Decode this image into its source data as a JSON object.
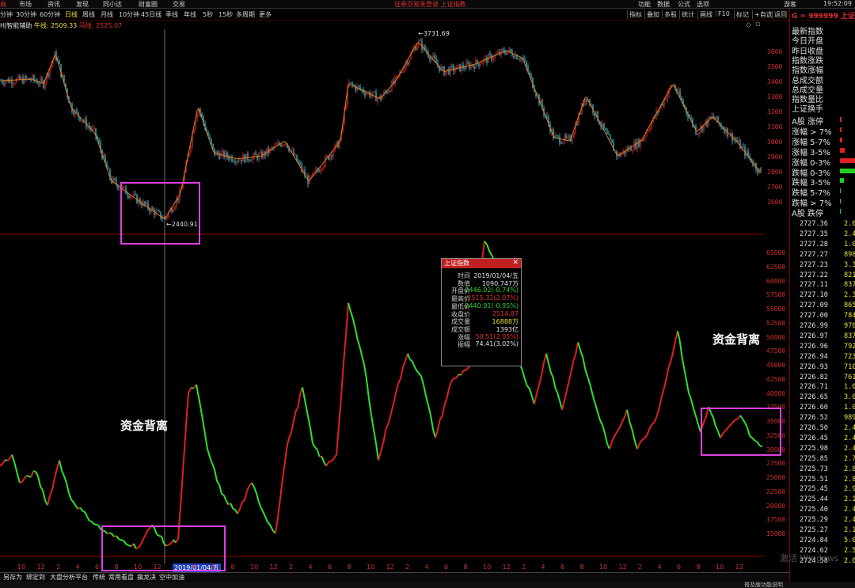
{
  "menu": {
    "items": [
      "市场",
      "资讯",
      "发现",
      "同小达",
      "财富圈",
      "交易"
    ],
    "center": "证券交易未登录  上证指数",
    "right": [
      "功能",
      "数据",
      "公式",
      "选项"
    ],
    "user": "游客",
    "time": "19:52:09"
  },
  "periods": {
    "items": [
      "分钟",
      "30分钟",
      "60分钟",
      "日线",
      "周线",
      "月线",
      "10分钟",
      "45日线",
      "季线",
      "年线",
      "5秒",
      "15秒",
      "多周期",
      "更多"
    ],
    "tools": [
      "指标",
      "叠加",
      "多股",
      "统计",
      "画线",
      "F10",
      "标记",
      "+自选",
      "返回"
    ]
  },
  "indicator_line": {
    "name": "HJ智能辅助",
    "bull_label": "牛线:",
    "bull_value": "2509.33",
    "horse_label": "马线:",
    "horse_value": "2525.07"
  },
  "main_chart": {
    "high_label": "3731.69",
    "low_label": "2440.91",
    "y_ticks": [
      "3600",
      "3500",
      "3400",
      "3300",
      "3200",
      "3100",
      "3000",
      "2900",
      "2800",
      "2700",
      "2600"
    ]
  },
  "sub_chart": {
    "y_ticks": [
      "65000",
      "62500",
      "60000",
      "57500",
      "55000",
      "52500",
      "50000",
      "47500",
      "45000",
      "42500",
      "40000",
      "37500",
      "35000",
      "32500",
      "30000",
      "27500",
      "25000",
      "22500",
      "20000",
      "17500",
      "15000"
    ],
    "annotation_left": "资金背离",
    "annotation_right": "资金背离"
  },
  "x_axis": {
    "ticks": [
      "10",
      "12",
      "2",
      "4",
      "6",
      "8",
      "10",
      "12",
      "2019/01/04/五",
      "4",
      "6",
      "8",
      "10",
      "12",
      "2",
      "4",
      "6",
      "8",
      "10",
      "12",
      "2",
      "4",
      "6",
      "8",
      "10",
      "12",
      "2",
      "4",
      "6",
      "8",
      "10",
      "12",
      "2",
      "4",
      "6",
      "8",
      "10",
      "12"
    ]
  },
  "popup": {
    "title": "上证指数",
    "rows": [
      {
        "k": "时间",
        "v": "2019/01/04/五",
        "c": "#e0e0e0"
      },
      {
        "k": "数值",
        "v": "1090.747万",
        "c": "#e0e0e0"
      },
      {
        "k": "开盘价",
        "v": "2446.02(-0.74%)",
        "c": "#30d030"
      },
      {
        "k": "最高价",
        "v": "2515.32(2.07%)",
        "c": "#e03030"
      },
      {
        "k": "最低价",
        "v": "2440.91(-0.95%)",
        "c": "#30d030"
      },
      {
        "k": "收盘价",
        "v": "2514.87",
        "c": "#e03030"
      },
      {
        "k": "成交量",
        "v": "16888万",
        "c": "#e0e040"
      },
      {
        "k": "成交额",
        "v": "1393亿",
        "c": "#e0e0e0"
      },
      {
        "k": "涨幅",
        "v": "50.51(2.05%)",
        "c": "#e03030"
      },
      {
        "k": "振幅",
        "v": "74.41(3.02%)",
        "c": "#e0e0e0"
      }
    ]
  },
  "right_panel": {
    "code": "G = 999999 上证",
    "labels": [
      "最新指数",
      "今日开盘",
      "昨日收盘",
      "指数涨跌",
      "指数涨幅",
      "总成交额",
      "总成交量",
      "指数量比",
      "上证换手"
    ],
    "dist": [
      "A股 涨停",
      "涨幅 > 7%",
      "涨幅 5-7%",
      "涨幅 3-5%",
      "涨幅 0-3%",
      "跌幅 0-3%",
      "跌幅 3-5%",
      "跌幅 5-7%",
      "跌幅 > 7%",
      "A股 跌停"
    ],
    "ticks": [
      {
        "p": "2727.36",
        "v": "2.0"
      },
      {
        "p": "2727.35",
        "v": "2.4"
      },
      {
        "p": "2727.28",
        "v": "1.0"
      },
      {
        "p": "2727.27",
        "v": "898"
      },
      {
        "p": "2727.23",
        "v": "3.3"
      },
      {
        "p": "2727.22",
        "v": "821"
      },
      {
        "p": "2727.11",
        "v": "837"
      },
      {
        "p": "2727.10",
        "v": "2.3"
      },
      {
        "p": "2727.09",
        "v": "865"
      },
      {
        "p": "2727.00",
        "v": "784"
      },
      {
        "p": "2726.99",
        "v": "970"
      },
      {
        "p": "2726.97",
        "v": "837"
      },
      {
        "p": "2726.96",
        "v": "792"
      },
      {
        "p": "2726.94",
        "v": "723"
      },
      {
        "p": "2726.93",
        "v": "710"
      },
      {
        "p": "2726.82",
        "v": "761"
      },
      {
        "p": "2726.71",
        "v": "1.0"
      },
      {
        "p": "2726.65",
        "v": "3.6"
      },
      {
        "p": "2726.60",
        "v": "1.0"
      },
      {
        "p": "2726.52",
        "v": "989"
      },
      {
        "p": "2726.50",
        "v": "2.4"
      },
      {
        "p": "2726.45",
        "v": "2.4"
      },
      {
        "p": "2725.98",
        "v": "2.4"
      },
      {
        "p": "2725.85",
        "v": "2.7"
      },
      {
        "p": "2725.73",
        "v": "2.8"
      },
      {
        "p": "2725.51",
        "v": "2.8"
      },
      {
        "p": "2725.45",
        "v": "2.9"
      },
      {
        "p": "2725.44",
        "v": "2.1"
      },
      {
        "p": "2725.40",
        "v": "2.4"
      },
      {
        "p": "2725.29",
        "v": "2.4"
      },
      {
        "p": "2725.27",
        "v": "2.1"
      },
      {
        "p": "2724.84",
        "v": "5.0"
      },
      {
        "p": "2724.62",
        "v": "2.5"
      },
      {
        "p": "2724.58",
        "v": "2.0"
      }
    ]
  },
  "bottom": {
    "items": [
      "另存为",
      "绑定到",
      "大盘分析平台",
      "传统",
      "常用看盘",
      "擒龙决",
      "空中加油"
    ],
    "windows_watermark": "激活 Windows",
    "status": "普及版功能说明"
  }
}
